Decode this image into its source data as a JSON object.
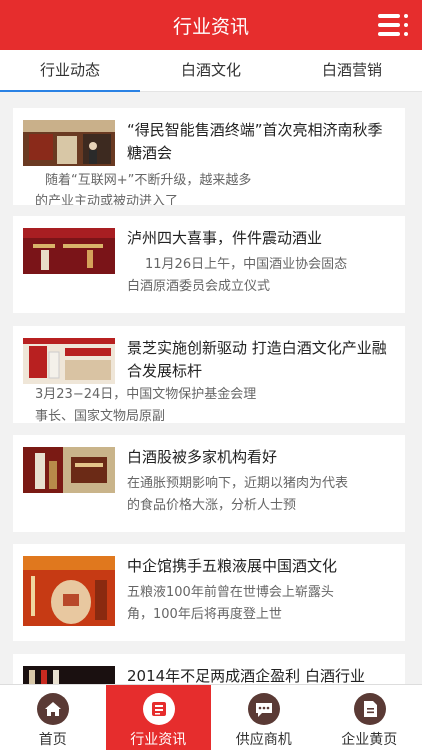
{
  "header": {
    "title": "行业资讯",
    "menu_icon": "menu-icon"
  },
  "tabs": [
    {
      "label": "行业动态",
      "active": true
    },
    {
      "label": "白酒文化",
      "active": false
    },
    {
      "label": "白酒营销",
      "active": false
    }
  ],
  "articles": [
    {
      "title": "“得民智能售酒终端”首次亮相济南秋季糖酒会",
      "summary_line1": "随着“互联网+”不断升级，越来越多",
      "summary_line2": "的产业主动或被动进入了"
    },
    {
      "title": "泸州四大喜事，件件震动酒业",
      "summary_line1": "11月26日上午，中国酒业协会固态",
      "summary_line2": "白酒原酒委员会成立仪式"
    },
    {
      "title": "景芝实施创新驱动 打造白酒文化产业融合发展标杆",
      "summary_line1": "3月23−24日，中国文物保护基金会理",
      "summary_line2": "事长、国家文物局原副"
    },
    {
      "title": "白酒股被多家机构看好",
      "summary_line1": "在通胀预期影响下，近期以猪肉为代表",
      "summary_line2": "的食品价格大涨，分析人士预"
    },
    {
      "title": "中企馆携手五粮液展中国酒文化",
      "summary_line1": "五粮液100年前曾在世博会上崭露头",
      "summary_line2": "角，100年后将再度登上世"
    },
    {
      "title": "2014年不足两成酒企盈利 白酒行业",
      "summary_line1": "",
      "summary_line2": ""
    }
  ],
  "bottom_nav": [
    {
      "label": "首页",
      "icon": "home-icon",
      "active": false
    },
    {
      "label": "行业资讯",
      "icon": "news-icon",
      "active": true
    },
    {
      "label": "供应商机",
      "icon": "chat-icon",
      "active": false
    },
    {
      "label": "企业黄页",
      "icon": "document-icon",
      "active": false
    }
  ],
  "colors": {
    "brand_red": "#e62d2d",
    "tab_underline": "#2a82e4",
    "icon_circle": "#5a3a35"
  }
}
